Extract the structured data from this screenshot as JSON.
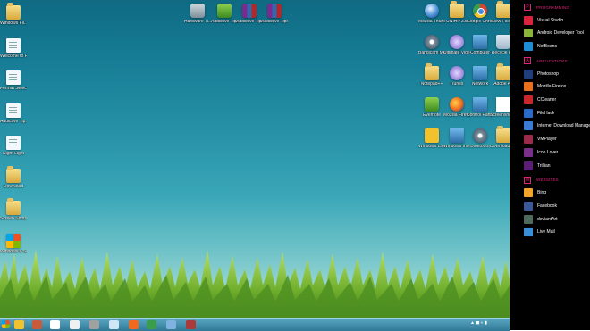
{
  "desktop": {
    "left_column": [
      {
        "label": "Windows Fil...",
        "icon": "folder-icon"
      },
      {
        "label": "Welcome to PowerPoint...",
        "icon": "document-icon"
      },
      {
        "label": "Format Selection.jpg",
        "icon": "image-icon"
      },
      {
        "label": "Addictive Tip...",
        "icon": "document-icon"
      },
      {
        "label": "Night Light",
        "icon": "document-icon"
      },
      {
        "label": "Download",
        "icon": "folder-icon"
      },
      {
        "label": "Screen Shots GB",
        "icon": "folder-icon"
      },
      {
        "label": "Windows 8 Screen",
        "icon": "windows-logo-icon"
      }
    ],
    "top_row": [
      {
        "label": "Hardware Ti...",
        "icon": "tool-icon"
      },
      {
        "label": "Addictive Tips Wallpapers",
        "icon": "archive-icon"
      },
      {
        "label": "Addictive Tips Wallpapers (1)",
        "icon": "rar-icon"
      },
      {
        "label": "Addictive Tips Wallpapers (2)",
        "icon": "rar-icon"
      }
    ],
    "right_grid": [
      [
        {
          "label": "Mozilla Thunderbird",
          "icon": "thunderbird-icon"
        },
        {
          "label": "UNIHP 3.5",
          "icon": "folder-icon"
        },
        {
          "label": "Google Chrome",
          "icon": "chrome-icon"
        },
        {
          "label": "New Folder",
          "icon": "folder-icon"
        }
      ],
      [
        {
          "label": "Bandicam Media Player",
          "icon": "gear-icon"
        },
        {
          "label": "Ultimate Video 1",
          "icon": "media-icon"
        },
        {
          "label": "Computer",
          "icon": "computer-icon"
        },
        {
          "label": "Recycle Bin",
          "icon": "recycle-bin-icon"
        }
      ],
      [
        {
          "label": "Notepad++",
          "icon": "folder-icon"
        },
        {
          "label": "iTunes",
          "icon": "media-icon"
        },
        {
          "label": "Network",
          "icon": "computer-icon"
        },
        {
          "label": "Adobe Air",
          "icon": "folder-icon"
        }
      ],
      [
        {
          "label": "Evernote",
          "icon": "evernote-icon"
        },
        {
          "label": "Mozilla Firefox",
          "icon": "firefox-icon"
        },
        {
          "label": "Control Panel",
          "icon": "computer-icon"
        },
        {
          "label": "Screenshot GB",
          "icon": "paper-icon"
        }
      ],
      [
        {
          "label": "Windows Live",
          "icon": "messenger-icon"
        },
        {
          "label": "Windows Internet",
          "icon": "computer-icon"
        },
        {
          "label": "Bluetooth",
          "icon": "gear-icon"
        },
        {
          "label": "Download Folder",
          "icon": "folder-icon"
        }
      ]
    ]
  },
  "taskbar": {
    "buttons": [
      {
        "name": "explorer",
        "color": "#f2c12e"
      },
      {
        "name": "library",
        "color": "#c95a3a"
      },
      {
        "name": "mail",
        "color": "#ffffff"
      },
      {
        "name": "messenger",
        "color": "#f0f0f0"
      },
      {
        "name": "media",
        "color": "#a0a0a0"
      },
      {
        "name": "notepad",
        "color": "#cfe6f5"
      },
      {
        "name": "firefox",
        "color": "#f06a1e"
      },
      {
        "name": "chrome",
        "color": "#3a9d4c"
      },
      {
        "name": "internet",
        "color": "#7fb2e0"
      },
      {
        "name": "settings",
        "color": "#ab3a3a"
      }
    ]
  },
  "sidebar": {
    "sections": [
      {
        "badge": "P",
        "title": "PROGRAMMING",
        "items": [
          {
            "label": "Visual Studio",
            "color": "#d9243d"
          },
          {
            "label": "Android Developer Tool",
            "color": "#8ab33a"
          },
          {
            "label": "NetBeans",
            "color": "#1e8fd6"
          }
        ]
      },
      {
        "badge": "A",
        "title": "APPLICATIONS",
        "items": [
          {
            "label": "Photoshop",
            "color": "#1f3e7a"
          },
          {
            "label": "Mozilla Firefox",
            "color": "#e8701f"
          },
          {
            "label": "CCleaner",
            "color": "#c9282a"
          },
          {
            "label": "FileHack",
            "color": "#2a6bc8"
          },
          {
            "label": "Internet Download Manage",
            "color": "#3a7bd5"
          },
          {
            "label": "VMPlayer",
            "color": "#9a2b4a"
          },
          {
            "label": "Icon Lover",
            "color": "#7a2f88"
          },
          {
            "label": "Trillian",
            "color": "#5c1e74"
          }
        ]
      },
      {
        "badge": "W",
        "title": "WEBSITES",
        "items": [
          {
            "label": "Bing",
            "color": "#f2a32c"
          },
          {
            "label": "Facebook",
            "color": "#3b5998"
          },
          {
            "label": "deviantArt",
            "color": "#4e6a5a"
          },
          {
            "label": "Live Mail",
            "color": "#3a8fd8"
          }
        ]
      }
    ]
  }
}
